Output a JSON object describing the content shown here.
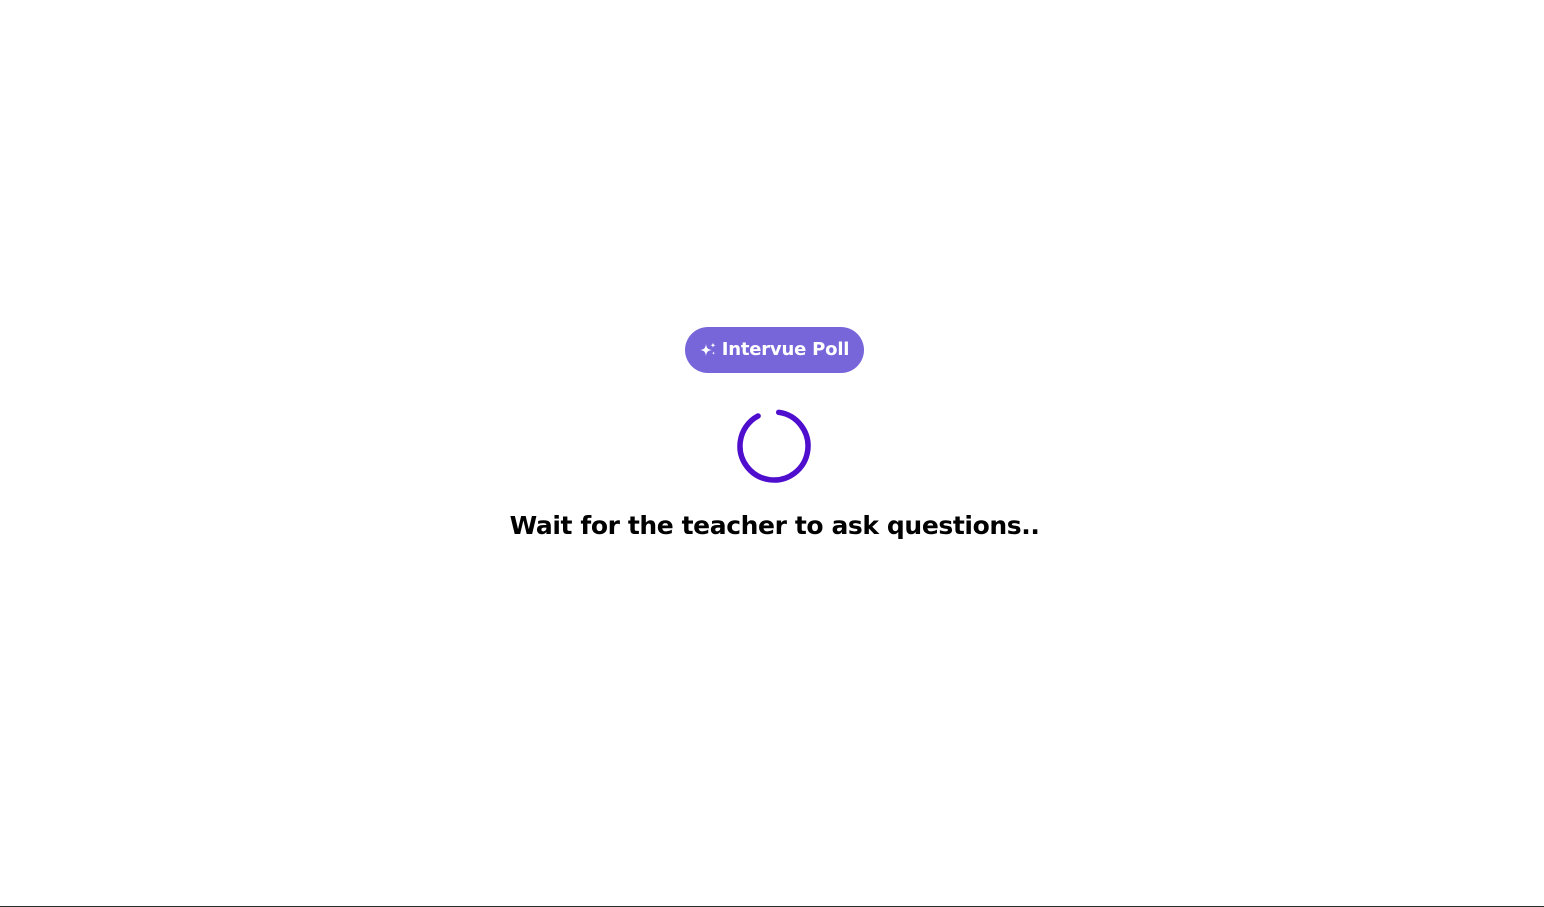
{
  "brand": {
    "label": "Intervue Poll",
    "icon": "sparkle-icon",
    "color": "#7765DA"
  },
  "loader": {
    "icon": "loading-spinner-icon",
    "color": "#4F0DCE"
  },
  "message": {
    "text": "Wait for the teacher to ask questions.."
  }
}
